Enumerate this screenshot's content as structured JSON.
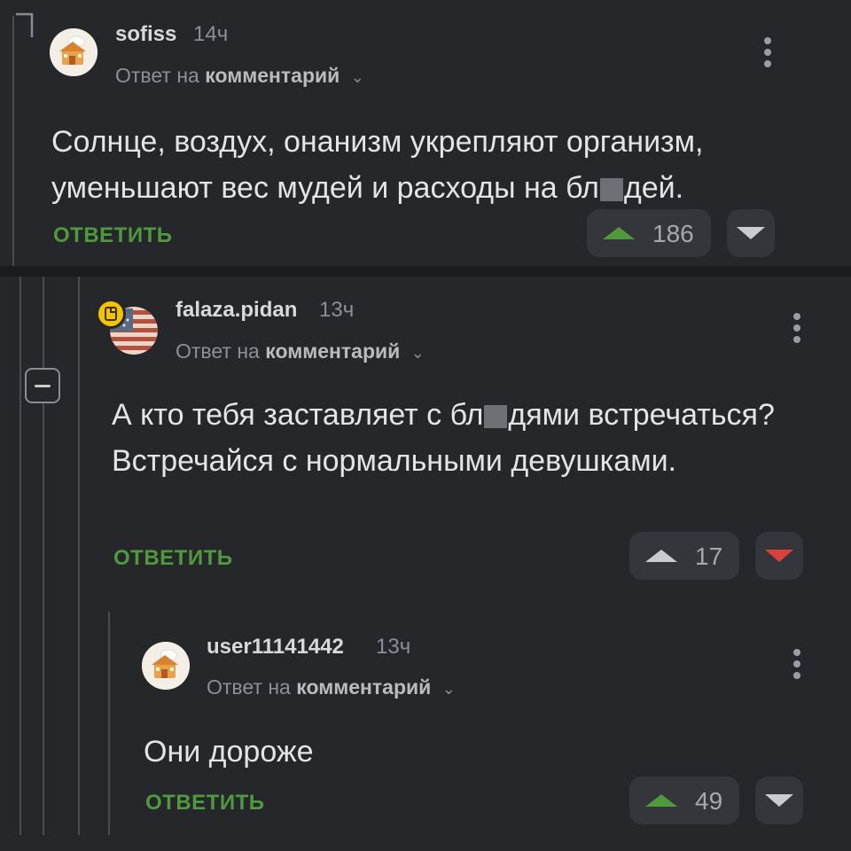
{
  "comments": [
    {
      "username": "sofiss",
      "time": "14ч",
      "reply_prefix": "Ответ на",
      "reply_target": "комментарий",
      "text_before": "Солнце, воздух, онанизм укрепляют организм, уменьшают вес мудей и расходы на бл",
      "text_after": "дей.",
      "reply_label": "ОТВЕТИТЬ",
      "votes": "186",
      "upvote_color": "#4f9a3c",
      "downvote_color": "#c9cbcf"
    },
    {
      "username": "falaza.pidan",
      "time": "13ч",
      "reply_prefix": "Ответ на",
      "reply_target": "комментарий",
      "text_before": "А кто тебя заставляет с бл",
      "text_after": "дями встречаться? Встречайся с нормальными девушками.",
      "reply_label": "ОТВЕТИТЬ",
      "votes": "17",
      "upvote_color": "#c9cbcf",
      "downvote_color": "#d9413a"
    },
    {
      "username": "user11141442",
      "time": "13ч",
      "reply_prefix": "Ответ на",
      "reply_target": "комментарий",
      "text": "Они дороже",
      "reply_label": "ОТВЕТИТЬ",
      "votes": "49",
      "upvote_color": "#4f9a3c",
      "downvote_color": "#c9cbcf"
    }
  ],
  "icons": {
    "avatar_1": "cafe-house-avatar",
    "avatar_2": "flag-avatar",
    "avatar_3": "cafe-house-avatar",
    "badge": "note-badge-icon",
    "menu": "kebab-menu-icon",
    "collapse": "collapse-thread-icon",
    "chevron": "chevron-down-icon"
  },
  "colors": {
    "background": "#222326",
    "accent_green": "#4f9a3c",
    "accent_red": "#d9413a",
    "badge_yellow": "#f2c400"
  }
}
